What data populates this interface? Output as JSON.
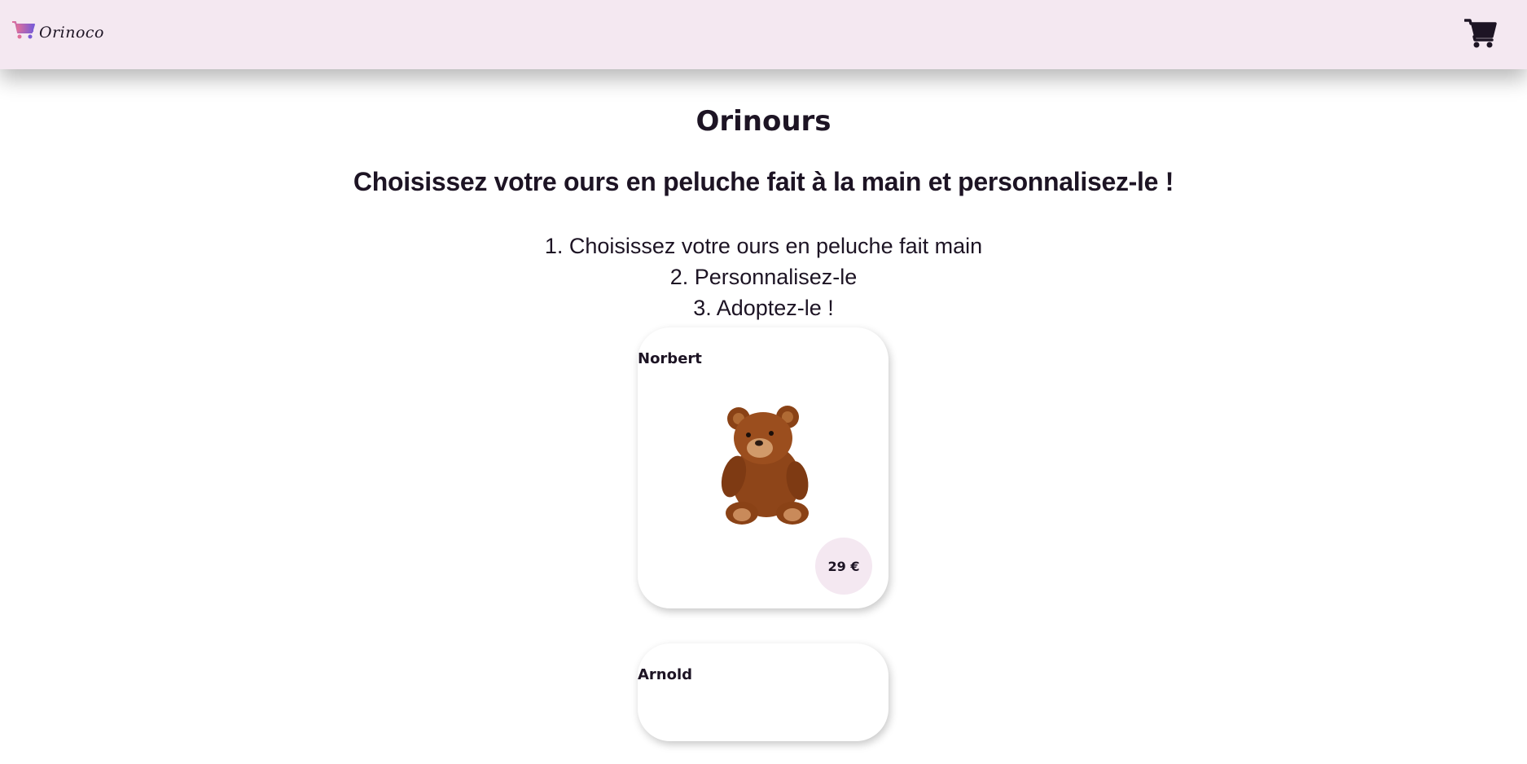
{
  "header": {
    "logo_text": "Orinoco",
    "logo_icon": "shopping-cart-gradient-icon",
    "cart_icon": "shopping-cart-icon"
  },
  "main": {
    "title": "Orinours",
    "subtitle": "Choisissez votre ours en peluche fait à la main et personnalisez-le !",
    "steps": [
      "1. Choisissez votre ours en peluche fait main",
      "2. Personnalisez-le",
      "3. Adoptez-le !"
    ]
  },
  "products": [
    {
      "name": "Norbert",
      "price": "29 €",
      "image": "brown-teddy-bear"
    },
    {
      "name": "Arnold"
    }
  ],
  "colors": {
    "header_bg": "#f4e8f1",
    "text": "#1d1424",
    "price_badge_bg": "#f4e8f1",
    "logo_gradient_start": "#e0709a",
    "logo_gradient_end": "#7a5bd6"
  }
}
